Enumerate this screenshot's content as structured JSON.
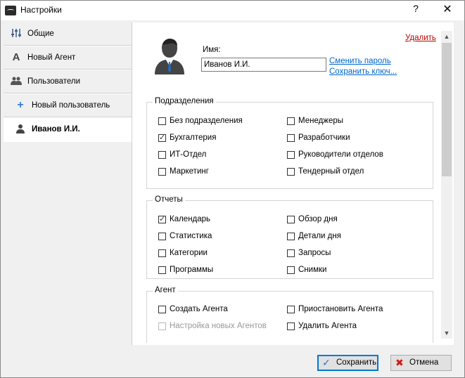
{
  "window": {
    "title": "Настройки",
    "help": "?",
    "close": "✕"
  },
  "sidebar": {
    "items": [
      {
        "label": "Общие",
        "icon": "sliders-icon"
      },
      {
        "label": "Новый Агент",
        "icon": "letter-a-icon"
      },
      {
        "label": "Пользователи",
        "icon": "users-icon"
      },
      {
        "label": "Новый пользователь",
        "icon": "plus-icon"
      },
      {
        "label": "Иванов И.И.",
        "icon": "user-icon",
        "active": true
      }
    ]
  },
  "user": {
    "name_label": "Имя:",
    "name_value": "Иванов И.И.",
    "delete_label": "Удалить",
    "change_password": "Сменить пароль",
    "save_key": "Сохранить ключ..."
  },
  "groups": {
    "departments": {
      "title": "Подразделения",
      "items": [
        {
          "label": "Без подразделения",
          "checked": false
        },
        {
          "label": "Менеджеры",
          "checked": false
        },
        {
          "label": "Бухгалтерия",
          "checked": true
        },
        {
          "label": "Разработчики",
          "checked": false
        },
        {
          "label": "ИТ-Отдел",
          "checked": false
        },
        {
          "label": "Руководители отделов",
          "checked": false
        },
        {
          "label": "Маркетинг",
          "checked": false
        },
        {
          "label": "Тендерный отдел",
          "checked": false
        }
      ]
    },
    "reports": {
      "title": "Отчеты",
      "items": [
        {
          "label": "Календарь",
          "checked": true
        },
        {
          "label": "Обзор дня",
          "checked": false
        },
        {
          "label": "Статистика",
          "checked": false
        },
        {
          "label": "Детали дня",
          "checked": false
        },
        {
          "label": "Категории",
          "checked": false
        },
        {
          "label": "Запросы",
          "checked": false
        },
        {
          "label": "Программы",
          "checked": false
        },
        {
          "label": "Снимки",
          "checked": false
        }
      ]
    },
    "agent": {
      "title": "Агент",
      "items": [
        {
          "label": "Создать Агента",
          "checked": false
        },
        {
          "label": "Приостановить Агента",
          "checked": false
        },
        {
          "label": "Настройка новых Агентов",
          "checked": false,
          "disabled": true
        },
        {
          "label": "Удалить Агента",
          "checked": false
        }
      ]
    }
  },
  "footer": {
    "save_label": "Сохранить",
    "cancel_label": "Отмена"
  }
}
